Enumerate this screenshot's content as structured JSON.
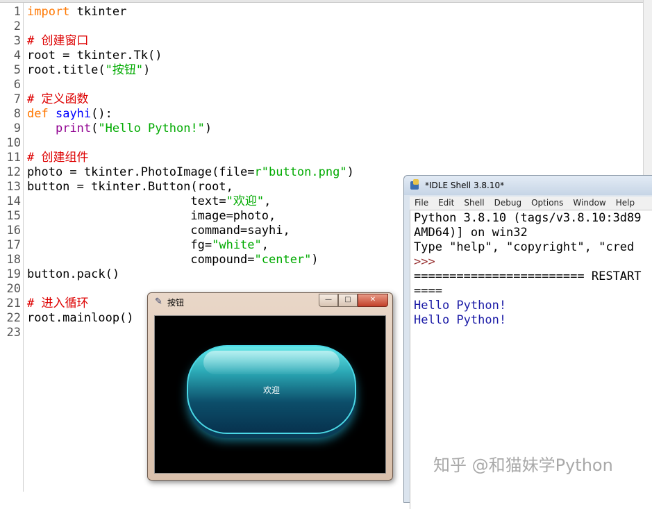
{
  "editor": {
    "line_numbers": [
      "1",
      "2",
      "3",
      "4",
      "5",
      "6",
      "7",
      "8",
      "9",
      "10",
      "11",
      "12",
      "13",
      "14",
      "15",
      "16",
      "17",
      "18",
      "19",
      "20",
      "21",
      "22",
      "23"
    ],
    "code": {
      "l1": {
        "a": "import",
        "b": " tkinter"
      },
      "l3": "# 创建窗口",
      "l4": "root = tkinter.Tk()",
      "l5": {
        "a": "root.title(",
        "b": "\"按钮\"",
        "c": ")"
      },
      "l7": "# 定义函数",
      "l8": {
        "a": "def",
        "b": " ",
        "c": "sayhi",
        "d": "():"
      },
      "l9": {
        "a": "    ",
        "b": "print",
        "c": "(",
        "d": "\"Hello Python!\"",
        "e": ")"
      },
      "l11": "# 创建组件",
      "l12": {
        "a": "photo = tkinter.PhotoImage(file=",
        "b": "r\"button.png\"",
        "c": ")"
      },
      "l13": "button = tkinter.Button(root,",
      "l14": {
        "a": "                       text=",
        "b": "\"欢迎\"",
        "c": ","
      },
      "l15": "                       image=photo,",
      "l16": "                       command=sayhi,",
      "l17": {
        "a": "                       fg=",
        "b": "\"white\"",
        "c": ","
      },
      "l18": {
        "a": "                       compound=",
        "b": "\"center\"",
        "c": ")"
      },
      "l19": "button.pack()",
      "l21": "# 进入循环",
      "l22": "root.mainloop()"
    }
  },
  "tk_window": {
    "icon": "feather-icon",
    "title": "按钮",
    "minimize_symbol": "—",
    "maximize_symbol": "□",
    "close_symbol": "✕",
    "button_text": "欢迎"
  },
  "shell": {
    "icon": "idle-icon",
    "title": "*IDLE Shell 3.8.10*",
    "menu": [
      "File",
      "Edit",
      "Shell",
      "Debug",
      "Options",
      "Window",
      "Help"
    ],
    "lines": [
      "Python 3.8.10 (tags/v3.8.10:3d89",
      "AMD64)] on win32",
      "Type \"help\", \"copyright\", \"cred",
      ">>>",
      "======================== RESTART",
      "====",
      "Hello Python!",
      "Hello Python!"
    ]
  },
  "watermark": "知乎 @和猫妹学Python",
  "colors": {
    "keyword": "#ff7700",
    "comment": "#dd0000",
    "string": "#00aa00",
    "builtin": "#900090",
    "definition": "#0000ff",
    "shell_output": "#1a1aa6"
  }
}
